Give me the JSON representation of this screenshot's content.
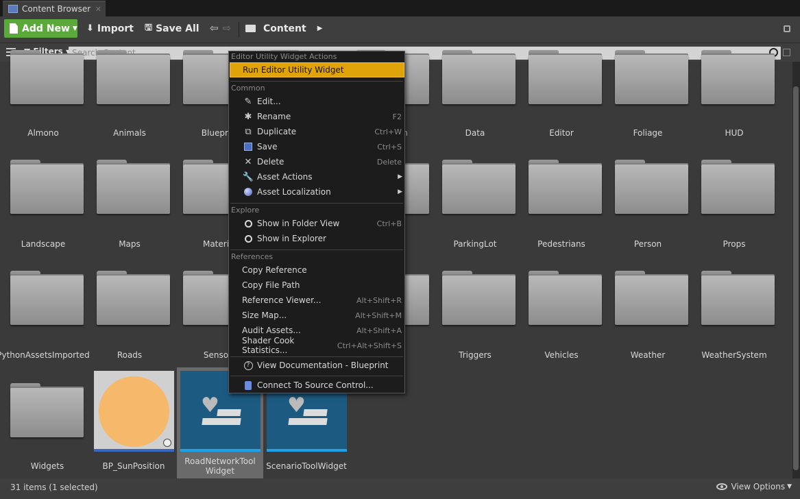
{
  "tab": {
    "title": "Content Browser",
    "close": "✕"
  },
  "toolbar": {
    "add_new": "Add New",
    "import": "Import",
    "save_all": "Save All",
    "breadcrumb": "Content"
  },
  "filters": {
    "label": "Filters",
    "search_placeholder": "Search Content"
  },
  "folders_row1": [
    "Almono",
    "Animals",
    "Bluepri",
    "",
    "",
    "Data",
    "Editor",
    "Foliage",
    "HUD"
  ],
  "folders_row2": [
    "Landscape",
    "Maps",
    "Materi",
    "",
    "s",
    "ParkingLot",
    "Pedestrians",
    "Person",
    "Props"
  ],
  "folders_row3": [
    "PythonAssetsImported",
    "Roads",
    "Senso",
    "",
    "ntent",
    "Triggers",
    "Vehicles",
    "Weather",
    "WeatherSystem"
  ],
  "partial_row1": "n",
  "assets": {
    "widgets_folder": "Widgets",
    "bp_sun": "BP_SunPosition",
    "road_tool": "RoadNetworkTool\nWidget",
    "road_tool_l1": "RoadNetworkTool",
    "road_tool_l2": "Widget",
    "scenario_tool": "ScenarioToolWidget"
  },
  "status": {
    "count": "31 items (1 selected)",
    "view_options": "View Options"
  },
  "menu": {
    "sec_widget": "Editor Utility Widget Actions",
    "run_widget": "Run Editor Utility Widget",
    "sec_common": "Common",
    "edit": "Edit...",
    "rename": "Rename",
    "rename_sc": "F2",
    "duplicate": "Duplicate",
    "duplicate_sc": "Ctrl+W",
    "save": "Save",
    "save_sc": "Ctrl+S",
    "delete": "Delete",
    "delete_sc": "Delete",
    "asset_actions": "Asset Actions",
    "asset_localization": "Asset Localization",
    "sec_explore": "Explore",
    "show_folder": "Show in Folder View",
    "show_folder_sc": "Ctrl+B",
    "show_explorer": "Show in Explorer",
    "sec_references": "References",
    "copy_ref": "Copy Reference",
    "copy_path": "Copy File Path",
    "ref_viewer": "Reference Viewer...",
    "ref_viewer_sc": "Alt+Shift+R",
    "size_map": "Size Map...",
    "size_map_sc": "Alt+Shift+M",
    "audit": "Audit Assets...",
    "audit_sc": "Alt+Shift+A",
    "shader_stats": "Shader Cook Statistics...",
    "shader_stats_sc": "Ctrl+Alt+Shift+S",
    "view_docs": "View Documentation - Blueprint",
    "connect_sc": "Connect To Source Control..."
  },
  "colors": {
    "add_new_green": "#5ca93b",
    "highlight_orange": "#e0a40a",
    "widget_blue": "#1d5a82",
    "selection_bar": "#1fa1ea"
  }
}
